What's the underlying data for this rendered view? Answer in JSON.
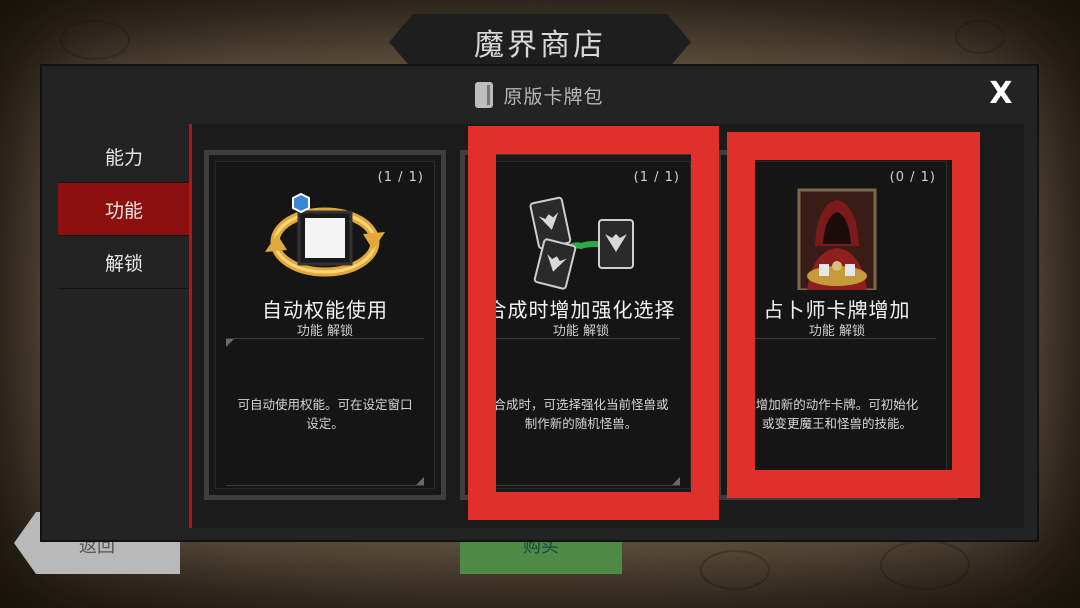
{
  "shop": {
    "title": "魔界商店",
    "back_label": "返回",
    "buy_label": "购买"
  },
  "modal": {
    "title": "原版卡牌包",
    "close_label": "X"
  },
  "sidebar": {
    "items": [
      {
        "label": "能力",
        "active": false
      },
      {
        "label": "功能",
        "active": true
      },
      {
        "label": "解锁",
        "active": false
      }
    ]
  },
  "cards": [
    {
      "count": "(1 / 1)",
      "name": "自动权能使用",
      "type": "功能 解锁",
      "desc_line1": "可自动使用权能。可在设定窗口",
      "desc_line2": "设定。",
      "art": "auto-cycle-icon"
    },
    {
      "count": "(1 / 1)",
      "name": "合成时增加强化选择",
      "type": "功能 解锁",
      "desc_line1": "合成时，可选择强化当前怪兽或",
      "desc_line2": "制作新的随机怪兽。",
      "art": "monster-cards-icon"
    },
    {
      "count": "(0 / 1)",
      "name": "占卜师卡牌增加",
      "type": "功能 解锁",
      "desc_line1": "增加新的动作卡牌。可初始化",
      "desc_line2": "或变更魔王和怪兽的技能。",
      "art": "fortune-teller-portrait"
    }
  ],
  "colors": {
    "active_tab": "#8c1010",
    "highlight": "#e0302c",
    "accent_gold": "#e2a93a"
  }
}
